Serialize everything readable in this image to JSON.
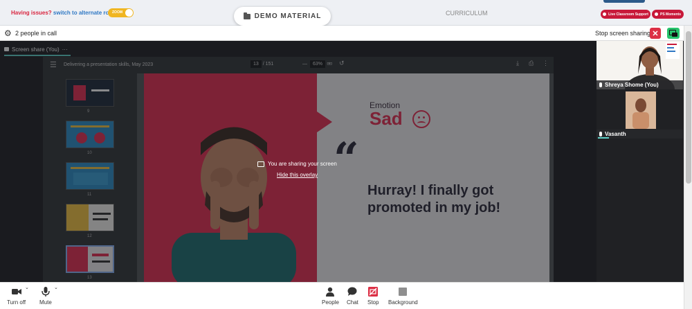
{
  "topbar": {
    "issues_text": "Having issues?",
    "switch_link": "switch to alternate room",
    "zoom_toggle_label": "ZOOM",
    "demo_button": "DEMO MATERIAL",
    "curriculum": "CURRICULUM",
    "live_support": "Live Classroom Support",
    "ps_moments": "PS Moments",
    "accent": "#c8193a"
  },
  "callbar": {
    "people_count": "2 people in call",
    "stop_sharing": "Stop screen sharing"
  },
  "share_tab": {
    "label": "Screen share (You)",
    "more": "···"
  },
  "viewer": {
    "title": "Delivering a presentation skills, May 2023",
    "page_current": "13",
    "page_total": "/ 151",
    "zoom": "63%",
    "thumbnails": [
      "9",
      "10",
      "11",
      "12",
      "13"
    ]
  },
  "slide": {
    "emotion_label": "Emotion",
    "emotion_value": "Sad",
    "quote_mark": "“",
    "quote": "Hurray! I finally got promoted in my job!"
  },
  "overlay": {
    "message": "You are sharing your screen",
    "hide_link": "Hide this overlay"
  },
  "participants": [
    {
      "name": "Shreya Shome (You)"
    },
    {
      "name": "Vasanth"
    }
  ],
  "controls": {
    "camera": "Turn off",
    "mic": "Mute",
    "people": "People",
    "chat": "Chat",
    "stop": "Stop",
    "background": "Background"
  }
}
